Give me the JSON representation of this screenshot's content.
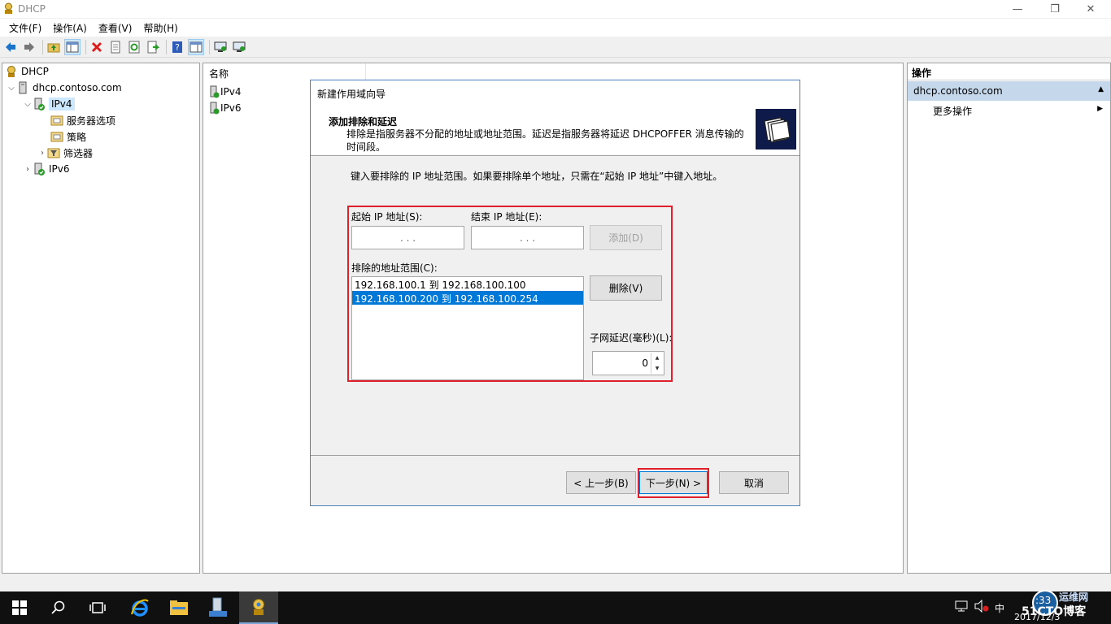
{
  "window": {
    "title": "DHCP",
    "minimize_glyph": "—",
    "restore_glyph": "❐",
    "close_glyph": "✕"
  },
  "menu": [
    {
      "label": "文件(F)"
    },
    {
      "label": "操作(A)"
    },
    {
      "label": "查看(V)"
    },
    {
      "label": "帮助(H)"
    }
  ],
  "toolbar": {
    "icons": [
      "back-arrow-icon",
      "forward-arrow-icon",
      "up-folder-icon",
      "show-hide-tree-icon",
      "delete-icon",
      "properties-icon",
      "refresh-icon",
      "export-list-icon",
      "help-icon",
      "show-hide-action-pane-icon",
      "authorize-server-icon",
      "unauthorize-server-icon"
    ]
  },
  "tree": {
    "root": "DHCP",
    "server": "dhcp.contoso.com",
    "ipv4": "IPv4",
    "server_options": "服务器选项",
    "policies": "策略",
    "filters": "筛选器",
    "ipv6": "IPv6"
  },
  "center": {
    "column_name": "名称",
    "items": [
      "IPv4",
      "IPv6"
    ]
  },
  "actions": {
    "header": "操作",
    "section": "dhcp.contoso.com",
    "more": "更多操作"
  },
  "wizard": {
    "title": "新建作用域向导",
    "section_title": "添加排除和延迟",
    "section_desc": "排除是指服务器不分配的地址或地址范围。延迟是指服务器将延迟 DHCPOFFER 消息传输的时间段。",
    "instruction": "键入要排除的 IP 地址范围。如果要排除单个地址，只需在“起始 IP 地址”中键入地址。",
    "start_ip_label": "起始 IP 地址(S):",
    "end_ip_label": "结束 IP 地址(E):",
    "ip_dots": ". . .",
    "add_button": "添加(D)",
    "excluded_label": "排除的地址范围(C):",
    "excluded_ranges": [
      "192.168.100.1 到 192.168.100.100",
      "192.168.100.200 到 192.168.100.254"
    ],
    "selected_index": 1,
    "remove_button": "删除(V)",
    "delay_label": "子网延迟(毫秒)(L):",
    "delay_value": "0",
    "back_button": "< 上一步(B)",
    "next_button": "下一步(N) >",
    "cancel_button": "取消"
  },
  "taskbar": {
    "tray_lang": "中",
    "clock_time": ":33",
    "clock_date": "2017/12/3",
    "watermark_line1": "运维网",
    "watermark_line2": "51CTO博客"
  },
  "colors": {
    "selection": "#0078d7",
    "highlight_box": "#e0202a",
    "action_section": "#c5d7ea"
  }
}
